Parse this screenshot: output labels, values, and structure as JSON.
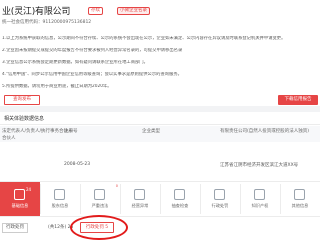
{
  "header": {
    "title": "业(灵江)有限公司",
    "badge_1": "存续",
    "badge_2": "小微企业名录",
    "credit_code": "统一社会信用代码：91120000975136812"
  },
  "notice": {
    "lines": [
      "1.以上为系统中获取的信息，公示期间不符合存续、公示的系统不会出现在公示，企业如未满足、公示内容存在异议请及时联系登记机关并申请变更。",
      "2.企业因未按期提交或提交的年度报告不符合要求被列入经营异常名录的，可提交申请移出名录",
      "3.企业信息公示系统会定期更新数据，如有疑问请联系企业所在地工商部门。",
      "4.\"信用中国\"、同步公示信用中国企业信用等级查询；会以实事求是原则提供公示的查询服务。",
      "5.所提供数据，请勿用于商业用途，截止日期为2020年。"
    ],
    "btn_ghost": "查询发布",
    "btn_red": "下载信用报告"
  },
  "section": {
    "title": "相关体验数据信息",
    "headers": [
      "法定代表人/负责人/执行事务合伙人",
      "注册号",
      "企业类型",
      "有限责任公司(自然人投资或控股的法人独资)"
    ],
    "headers_row2": [
      "合伙人"
    ],
    "row": [
      "",
      "2008-05-23",
      "",
      "江苏省江阴市经济开发区滨江大道XX号"
    ]
  },
  "tabs": [
    {
      "label": "基础信息",
      "num": "24",
      "active": true,
      "icon": "doc-icon"
    },
    {
      "label": "股东信息",
      "num": "",
      "active": false,
      "icon": "people-icon"
    },
    {
      "label": "严重违法",
      "num": "",
      "active": false,
      "icon": "warn-icon",
      "cnt": "0"
    },
    {
      "label": "经营异常",
      "num": "",
      "active": false,
      "icon": "alert-icon"
    },
    {
      "label": "抽查检查",
      "num": "",
      "active": false,
      "icon": "check-icon"
    },
    {
      "label": "行政处罚",
      "num": "",
      "active": false,
      "icon": "gavel-icon"
    },
    {
      "label": "知识产权",
      "num": "",
      "active": false,
      "icon": "bulb-icon"
    },
    {
      "label": "其他信息",
      "num": "",
      "active": false,
      "icon": "more-icon"
    }
  ],
  "bottom": {
    "select_1": "行政处罚",
    "select_2": "(共12条) 25",
    "count_button": "行政处罚 5"
  },
  "colors": {
    "accent": "#e64545",
    "circle": "#e21b1b"
  }
}
